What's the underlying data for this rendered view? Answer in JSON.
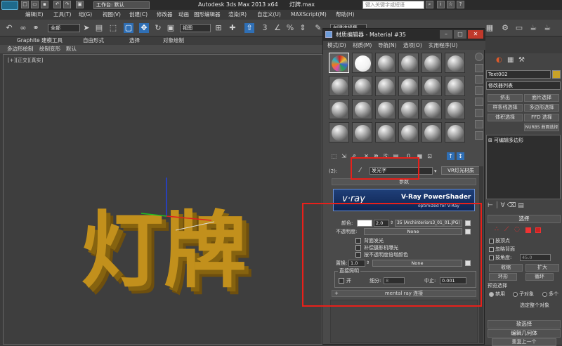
{
  "titlebar": {
    "workspace_label": "工作台: 默认",
    "title": "Autodesk 3ds Max  2013 x64",
    "file": "灯牌.max",
    "search_placeholder": "键入关键字或短语"
  },
  "menubar": [
    "编辑(E)",
    "工具(T)",
    "组(G)",
    "视图(V)",
    "创建(C)",
    "修改器",
    "动画",
    "图形编辑器",
    "渲染(R)",
    "自定义(U)",
    "MAXScript(M)",
    "帮助(H)"
  ],
  "toolbar": {
    "filter": "全部",
    "view": "视图",
    "selection_set": "创建选择集"
  },
  "ribbon": {
    "tabs": [
      "Graphite 建模工具",
      "自由形式",
      "选择",
      "对象绘制"
    ],
    "subtabs": [
      "多边形绘制",
      "绘制变形",
      "默认"
    ]
  },
  "viewport": {
    "label": "[+][正交][真实]",
    "object_text": "灯牌"
  },
  "colors": {
    "accent_red": "#e8201a",
    "object_gold": "#c2901c",
    "axis_x": "#e02020",
    "axis_y": "#20c020",
    "axis_z": "#2040e0"
  },
  "mated": {
    "title": "材质编辑器 - Material #35",
    "menu": [
      "模式(D)",
      "材质(M)",
      "导航(N)",
      "选项(O)",
      "实用程序(U)"
    ],
    "slot_label": "(2):",
    "material_name": "发光字",
    "material_type": "VR灯光材质",
    "rollout_params": "参数",
    "vray_banner_title": "V-Ray PowerShader",
    "vray_banner_sub": "optimized for V-Ray",
    "vray_logo": "v·ray",
    "color_label": "颜色:",
    "color_value": "2.0",
    "color_map": "35 (Archinteriors3_01_01.JPG)",
    "opacity_label": "不透明度:",
    "none1": "None",
    "backside": "背面发光",
    "compensate": "补偿摄影机曝光",
    "multiply_opacity": "按不透明度倍增颜色",
    "displace_label": "置换:",
    "displace_value": "1.0",
    "none2": "None",
    "direct_group": "直接照明",
    "on_label": "开",
    "subdivs_label": "细分:",
    "subdivs_value": "8",
    "cutoff_label": "中止:",
    "cutoff_value": "0.001",
    "mental_ray": "mental ray 连接"
  },
  "cmdpanel": {
    "object_name": "Text002",
    "modifier_list": "修改器列表",
    "buttons": [
      "挤出",
      "面片选择",
      "样条线选择",
      "多边形选择",
      "体积选择",
      "FFD 选择",
      "NURBS 曲面选择"
    ],
    "stack_item": "可编辑多边形",
    "selection_head": "选择",
    "by_vertex": "按顶点",
    "ignore_back": "忽略背面",
    "by_angle": "按角度:",
    "angle_value": "45.0",
    "shrink": "收缩",
    "grow": "扩大",
    "ring": "环形",
    "loop": "循环",
    "preview_sel": "预览选择",
    "disable": "禁用",
    "sub_object": "子对象",
    "multi": "多个",
    "select_whole": "选定整个对象",
    "soft_sel": "软选择",
    "edit_geom": "编辑几何体",
    "repeat_last": "重复上一个"
  }
}
